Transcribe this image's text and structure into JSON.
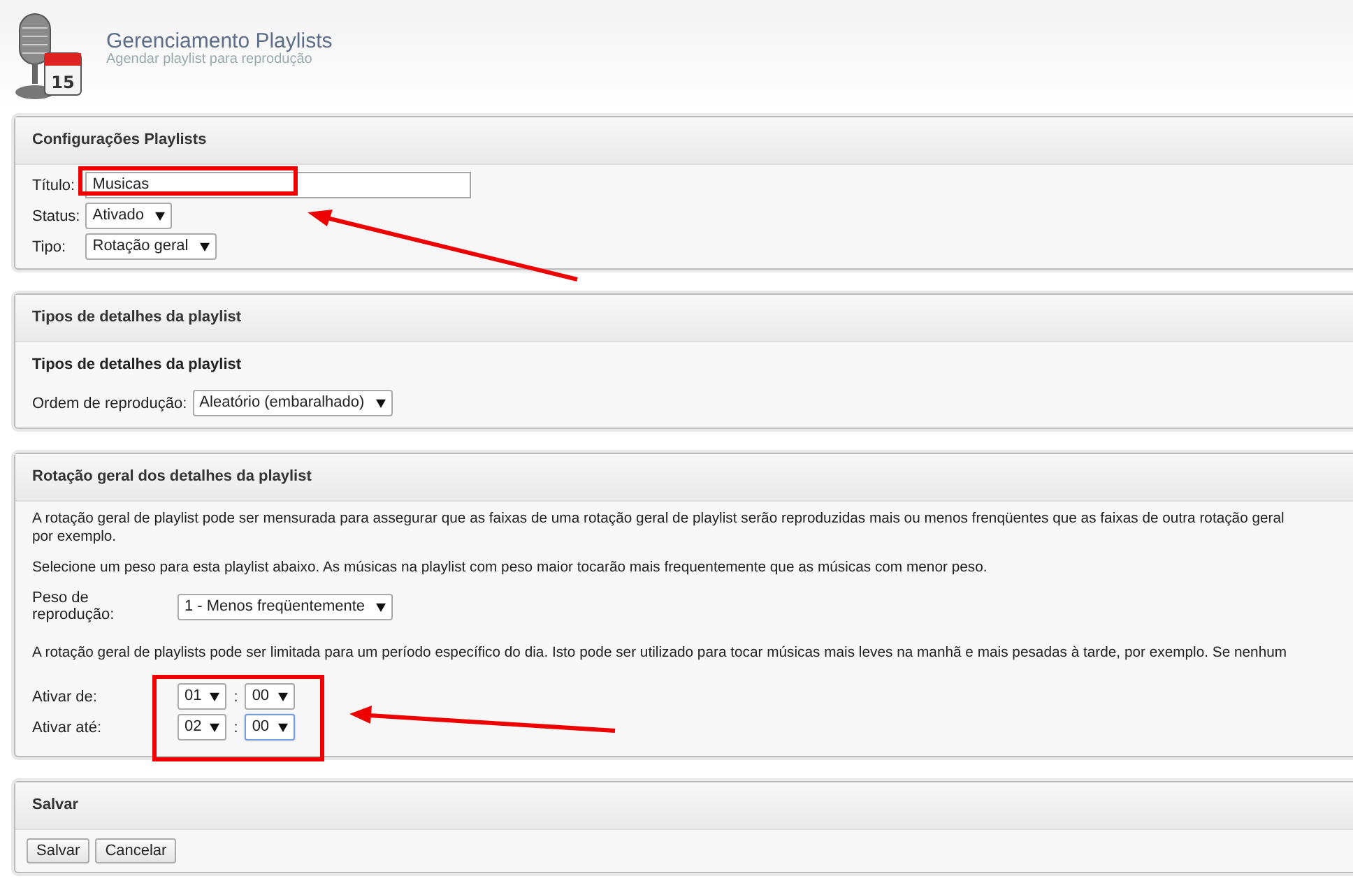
{
  "header": {
    "icon_day": "15",
    "title": "Gerenciamento Playlists",
    "subtitle": "Agendar playlist para reprodução"
  },
  "config_panel": {
    "title": "Configurações Playlists",
    "fields": [
      {
        "label": "Título:",
        "kind": "text",
        "value": "Musicas"
      },
      {
        "label": "Status:",
        "kind": "select",
        "value": "Ativado"
      },
      {
        "label": "Tipo:",
        "kind": "select",
        "value": "Rotação geral"
      }
    ]
  },
  "details_panel": {
    "title": "Tipos de detalhes da playlist",
    "heading": "Tipos de detalhes da playlist",
    "order_label": "Ordem de reprodução:",
    "order_value": "Aleatório (embaralhado)"
  },
  "rotation_panel": {
    "title": "Rotação geral dos detalhes da playlist",
    "intro_lines": [
      "A rotação geral de playlist pode ser mensurada para assegurar que as faixas de uma rotação geral de playlist serão reproduzidas mais ou menos frenqüentes que as faixas de outra rotação geral",
      "por exemplo."
    ],
    "weight_text": "Selecione um peso para esta playlist abaixo. As músicas na playlist com peso maior tocarão mais frequentemente que as músicas com menor peso.",
    "weight_label": "Peso de reprodução:",
    "weight_value": "1 - Menos freqüentemente",
    "limit_text": "A rotação geral de playlists pode ser limitada para um período específico do dia. Isto pode ser utilizado para tocar músicas mais leves na manhã e mais pesadas à tarde, por exemplo. Se nenhum",
    "times": [
      {
        "label": "Ativar de:",
        "hour": "01",
        "separator": ":",
        "minute": "00",
        "focused": false
      },
      {
        "label": "Ativar até:",
        "hour": "02",
        "separator": ":",
        "minute": "00",
        "focused": true
      }
    ]
  },
  "save_panel": {
    "title": "Salvar",
    "buttons": [
      "Salvar",
      "Cancelar"
    ]
  }
}
